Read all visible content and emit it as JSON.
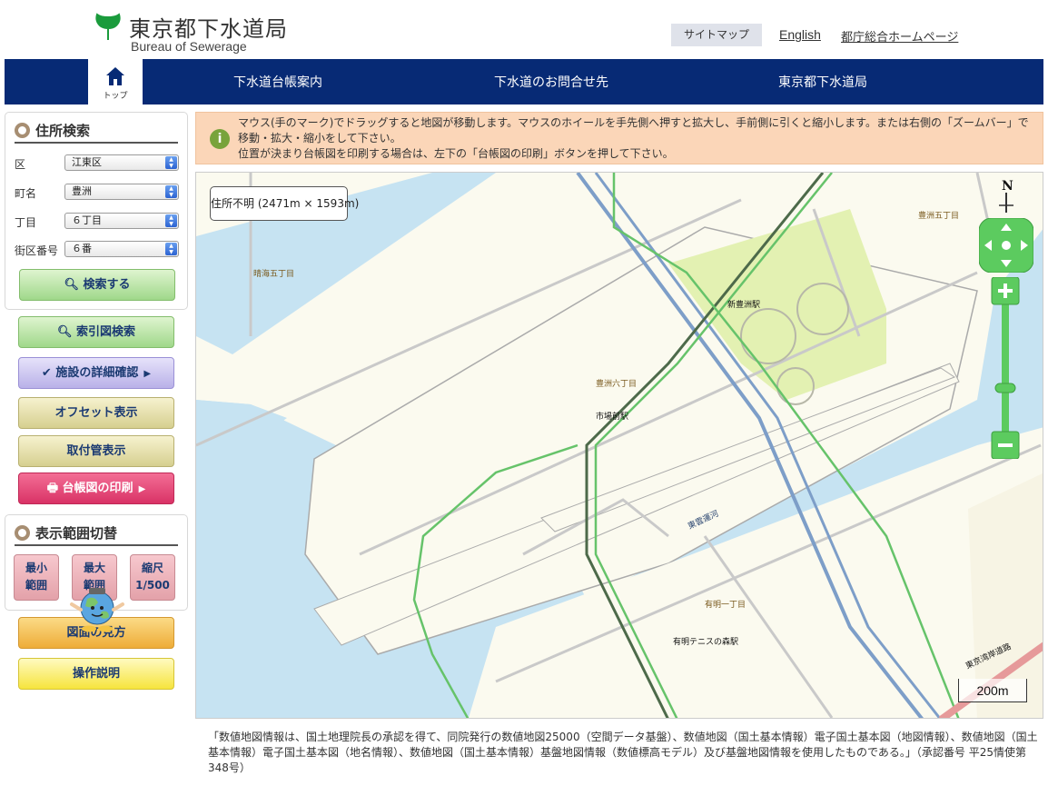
{
  "header": {
    "logo_jp": "東京都下水道局",
    "logo_en": "Bureau of Sewerage",
    "sitemap": "サイトマップ",
    "english": "English",
    "tocho_home": "都庁総合ホームページ"
  },
  "nav": {
    "home_label": "トップ",
    "items": [
      "下水道台帳案内",
      "下水道のお問合せ先",
      "東京都下水道局"
    ]
  },
  "address_search": {
    "title": "住所検索",
    "fields": [
      {
        "label": "区",
        "value": "江東区"
      },
      {
        "label": "町名",
        "value": "豊洲"
      },
      {
        "label": "丁目",
        "value": "６丁目"
      },
      {
        "label": "街区番号",
        "value": "６番"
      }
    ],
    "search_button": "検索する"
  },
  "buttons": {
    "index_search": "索引図検索",
    "facility_detail": "施設の詳細確認",
    "offset": "オフセット表示",
    "attached_pipe": "取付管表示",
    "print": "台帳図の印刷"
  },
  "range": {
    "title": "表示範囲切替",
    "min": [
      "最小",
      "範囲"
    ],
    "max": [
      "最大",
      "範囲"
    ],
    "scale": [
      "縮尺",
      "1/500"
    ]
  },
  "help": {
    "how_to_read": "図面の見方",
    "manual": "操作説明"
  },
  "info": {
    "line1": "マウス(手のマーク)でドラッグすると地図が移動します。マウスのホイールを手先側へ押すと拡大し、手前側に引くと縮小します。または右側の「ズームバー」で移動・拡大・縮小をして下さい。",
    "line2": "位置が決まり台帳図を印刷する場合は、左下の「台帳図の印刷」ボタンを押して下さい。"
  },
  "map": {
    "address_popup": "住所不明 (2471m × 1593m)",
    "labels": {
      "harumi5": "晴海五丁目",
      "toyosu5": "豊洲五丁目",
      "shintoyosu": "新豊洲駅",
      "toyosu6": "豊洲六丁目",
      "shijomae": "市場前駅",
      "canal": "東雲運河",
      "ariake1": "有明一丁目",
      "tennis": "有明テニスの森駅",
      "expressway": "東京湾岸道路"
    },
    "scale_bar": "200m",
    "compass": "N"
  },
  "footer_note": "「数値地図情報は、国土地理院長の承認を得て、同院発行の数値地図25000（空間データ基盤）、数値地図（国土基本情報）電子国土基本図（地図情報）、数値地図（国土基本情報）電子国土基本図（地名情報）、数値地図（国土基本情報）基盤地図情報（数値標高モデル）及び基盤地図情報を使用したものである。」（承認番号 平25情使第348号）",
  "colors": {
    "nav_bg": "#072a75",
    "water": "#c6e3f2",
    "land": "#fbfaef",
    "park": "#e3f1b2",
    "rail_green": "#66c36a",
    "rail_blue": "#7d9ec8",
    "map_control": "#5ccb5f"
  }
}
